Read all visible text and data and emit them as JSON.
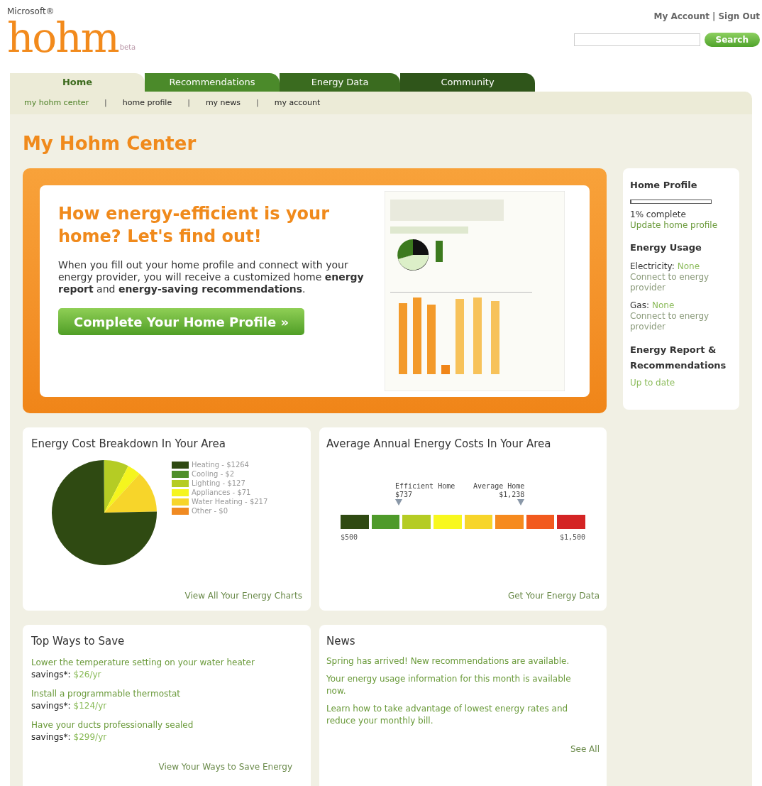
{
  "header": {
    "brand": "Microsoft®",
    "logo": "hohm",
    "logo_tag": "beta",
    "account_links": [
      "My Account",
      "Sign Out"
    ],
    "account_separator": "|",
    "search": {
      "button": "Search"
    }
  },
  "tabs": [
    {
      "label": "Home",
      "selected": true
    },
    {
      "label": "Recommendations",
      "selected": false
    },
    {
      "label": "Energy Data",
      "selected": false
    },
    {
      "label": "Community",
      "selected": false
    }
  ],
  "subnav": [
    {
      "label": "my hohm center",
      "selected": true
    },
    {
      "label": "home profile",
      "selected": false
    },
    {
      "label": "my news",
      "selected": false
    },
    {
      "label": "my account",
      "selected": false
    }
  ],
  "subnav_separators": [
    "|",
    "|",
    "|"
  ],
  "page_title": "My Hohm Center",
  "hero": {
    "title": "How energy-efficient is your home? Let's find out!",
    "body": "When you fill out your home profile and connect with your energy provider, you will receive a customized home **energy report** and **energy-saving recommendations**.",
    "button": "Complete Your Home Profile »"
  },
  "sidebar": {
    "home_profile": {
      "heading": "Home Profile",
      "level": 0.01,
      "status": "1% complete",
      "link": "Update home profile"
    },
    "energy_usage": {
      "heading": "Energy Usage",
      "items": [
        {
          "label": "Electricity:",
          "value": "None",
          "link": "Connect to energy provider"
        },
        {
          "label": "Gas:",
          "value": "None",
          "link": "Connect to energy provider"
        }
      ]
    },
    "report": {
      "heading": "Energy Report & Recommendations",
      "status": "Up to date"
    }
  },
  "cost_breakdown": {
    "title": "Energy Cost Breakdown In Your Area",
    "legend": [
      {
        "label": "Heating - $1264",
        "color": "#2f4a12"
      },
      {
        "label": "Cooling - $2",
        "color": "#4e8f2a"
      },
      {
        "label": "Lighting - $127",
        "color": "#b5cc24"
      },
      {
        "label": "Appliances - $71",
        "color": "#f5f51e"
      },
      {
        "label": "Water Heating - $217",
        "color": "#f7d52a"
      },
      {
        "label": "Other - $0",
        "color": "#f08a22"
      }
    ],
    "link": "View All Your Energy Charts"
  },
  "annual_costs": {
    "title": "Average Annual Energy Costs In Your Area",
    "markers": [
      {
        "label": "Efficient Home",
        "value": "$737"
      },
      {
        "label": "Average Home",
        "value": "$1,238"
      }
    ],
    "min_label": "$500",
    "max_label": "$1,500",
    "link": "Get Your Energy Data"
  },
  "ways_to_save": {
    "title": "Top Ways to Save",
    "items": [
      {
        "text": "Lower the temperature setting on your water heater",
        "savings_label": "savings*:",
        "savings": "$26/yr"
      },
      {
        "text": "Install a programmable thermostat",
        "savings_label": "savings*:",
        "savings": "$124/yr"
      },
      {
        "text": "Have your ducts professionally sealed",
        "savings_label": "savings*:",
        "savings": "$299/yr"
      }
    ],
    "link": "View Your Ways to Save Energy"
  },
  "news": {
    "title": "News",
    "items": [
      "Spring has arrived! New recommendations are available.",
      "Your energy usage information for this month is available now.",
      "Learn how to take advantage of lowest energy rates and reduce your monthly bill."
    ],
    "link": "See All"
  }
}
